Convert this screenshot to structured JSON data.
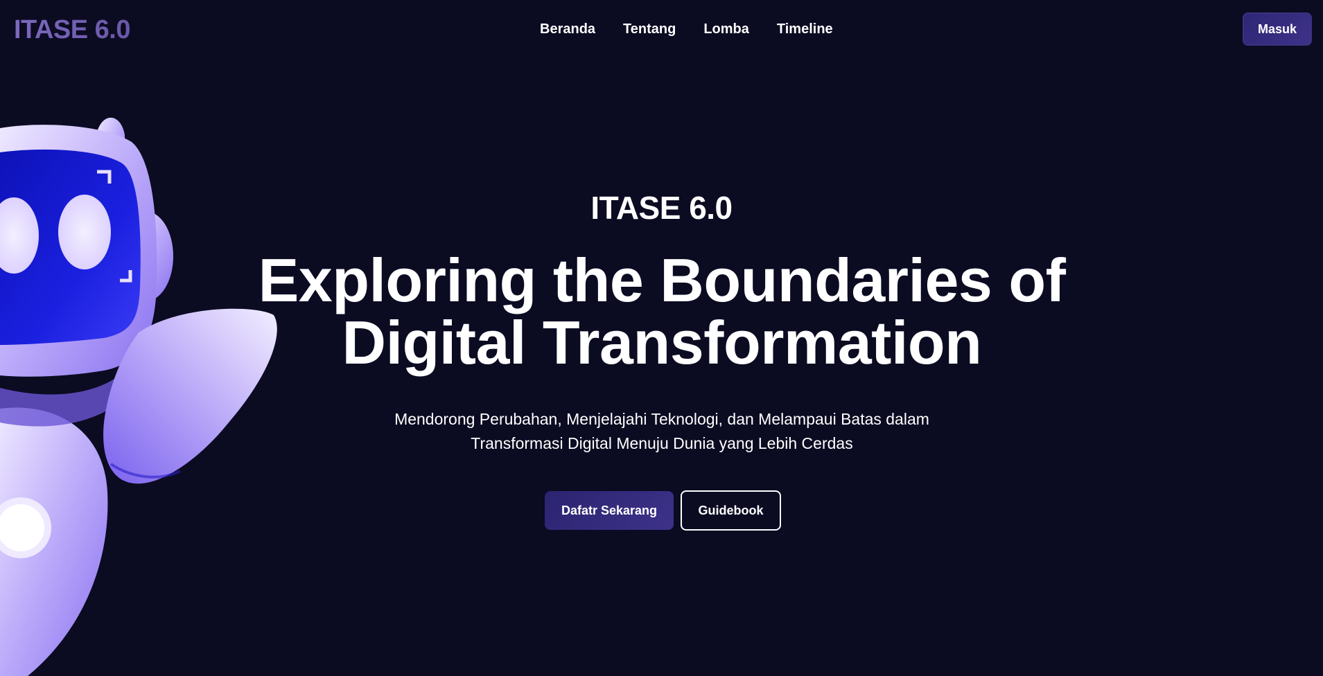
{
  "brand": {
    "logo_text": "ITASE 6.0"
  },
  "nav": {
    "items": [
      {
        "label": "Beranda"
      },
      {
        "label": "Tentang"
      },
      {
        "label": "Lomba"
      },
      {
        "label": "Timeline"
      }
    ],
    "login_label": "Masuk"
  },
  "hero": {
    "kicker": "ITASE 6.0",
    "title_line1": "Exploring the Boundaries of",
    "title_line2": "Digital Transformation",
    "subtitle_line1": "Mendorong Perubahan, Menjelajahi Teknologi, dan Melampaui Batas dalam",
    "subtitle_line2": "Transformasi Digital Menuju Dunia yang Lebih Cerdas",
    "primary_cta": "Dafatr Sekarang",
    "secondary_cta": "Guidebook"
  },
  "colors": {
    "background": "#0b0b22",
    "accent": "#2d2674",
    "logo": "#7c68bd",
    "robot_body": "#b7a6f7",
    "robot_visor": "#1a1fd8"
  },
  "illustration": {
    "name": "robot-mascot"
  }
}
